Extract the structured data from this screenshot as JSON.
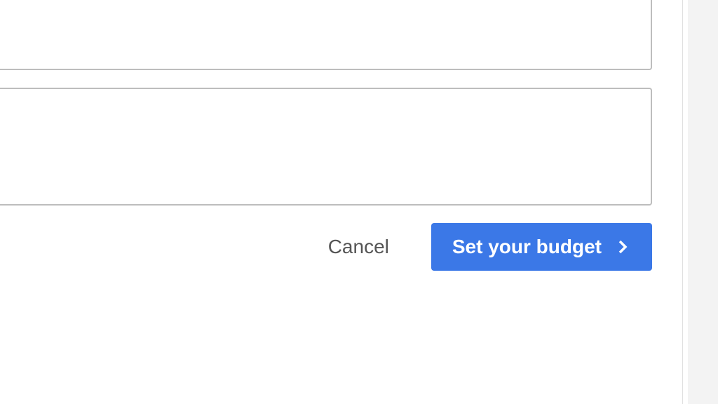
{
  "buttons": {
    "cancel": "Cancel",
    "primary": "Set your budget"
  },
  "colors": {
    "primary": "#3b78e7",
    "border": "#bdbdbd",
    "sidebar": "#f3f3f3"
  }
}
